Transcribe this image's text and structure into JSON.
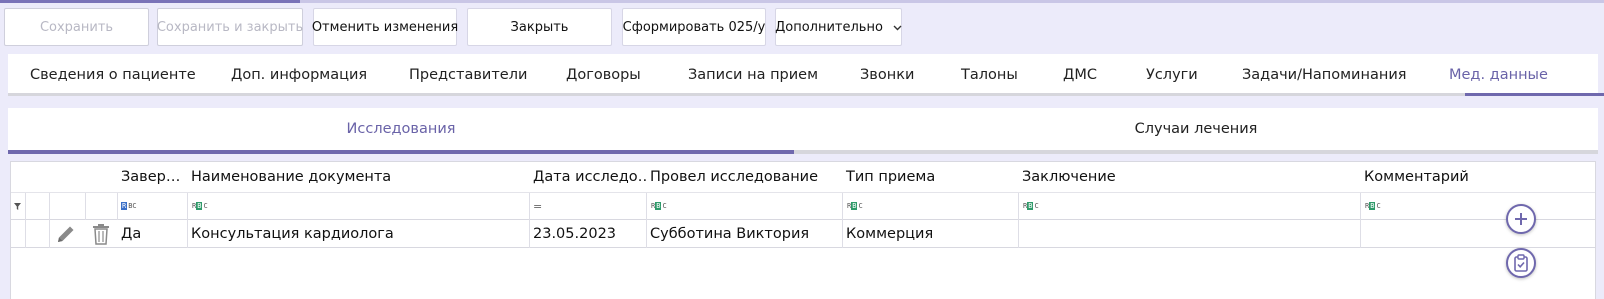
{
  "toolbar": {
    "save": "Сохранить",
    "save_close": "Сохранить и закрыть",
    "cancel_changes": "Отменить изменения",
    "close": "Закрыть",
    "form_025": "Сформировать 025/у",
    "more": "Дополнительно"
  },
  "tabs": [
    {
      "label": "Сведения о пациенте"
    },
    {
      "label": "Доп. информация"
    },
    {
      "label": "Представители"
    },
    {
      "label": "Договоры"
    },
    {
      "label": "Записи на прием"
    },
    {
      "label": "Звонки"
    },
    {
      "label": "Талоны"
    },
    {
      "label": "ДМС"
    },
    {
      "label": "Услуги"
    },
    {
      "label": "Задачи/Напоминания"
    },
    {
      "label": "Мед. данные"
    }
  ],
  "active_tab": "Мед. данные",
  "subtabs": [
    {
      "label": "Исследования"
    },
    {
      "label": "Случаи лечения"
    }
  ],
  "grid": {
    "columns": [
      {
        "label": "Завер…"
      },
      {
        "label": "Наименование документа"
      },
      {
        "label": "Дата исследо…"
      },
      {
        "label": "Провел исследование"
      },
      {
        "label": "Тип приема"
      },
      {
        "label": "Заключение"
      },
      {
        "label": "Комментарий"
      }
    ],
    "filter": {
      "completed_icon_a": "R",
      "completed_icon_b": "BC",
      "text_icon_a": "R",
      "text_icon_b": "B",
      "text_icon_c": "C",
      "date_icon": "="
    },
    "rows": [
      {
        "completed": "Да",
        "document": "Консультация кардиолога",
        "date": "23.05.2023",
        "performed_by": "Субботина Виктория",
        "visit_type": "Коммерция",
        "conclusion": "",
        "comment": ""
      }
    ]
  },
  "colors": {
    "accent": "#6f68ad",
    "background": "#ecebfa"
  },
  "icons": {
    "edit": "pencil-icon",
    "delete": "trash-icon",
    "filter": "filter-icon",
    "add": "plus-circle-icon",
    "clipboard": "clipboard-check-icon"
  }
}
